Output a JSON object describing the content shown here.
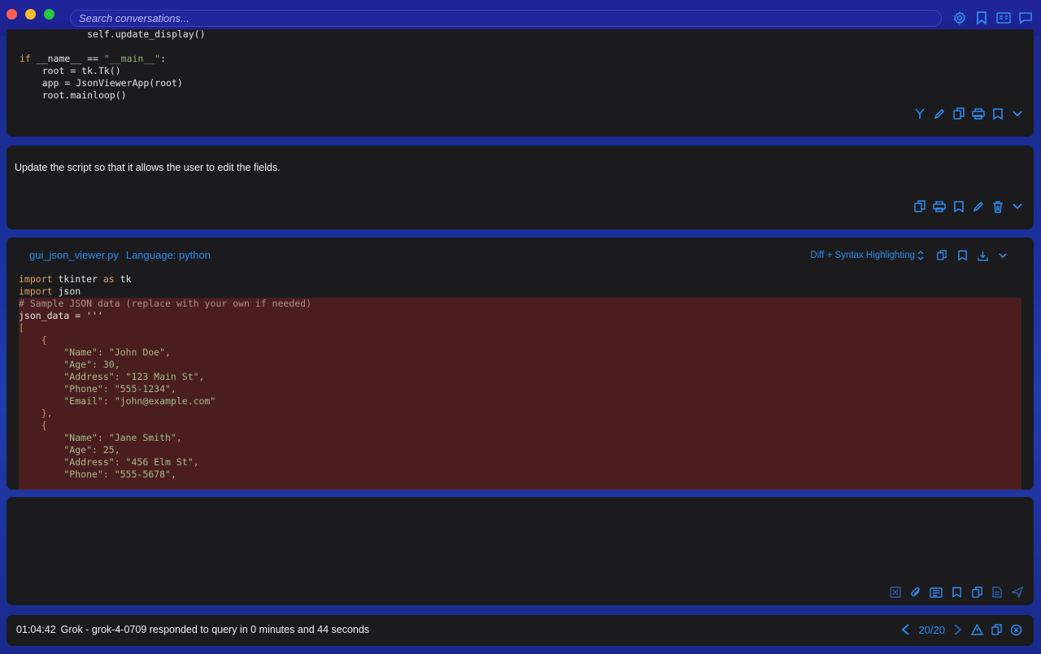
{
  "search": {
    "placeholder": "Search conversations..."
  },
  "colors": {
    "accent": "#2f8cf0",
    "panel_bg": "#1b1b1d",
    "diff_removed_bg": "#4a1e1e",
    "window_bg": "#1c2290"
  },
  "previous_code": {
    "lines": [
      {
        "indent": "            ",
        "text": "self.update_display()"
      },
      {
        "text": ""
      },
      {
        "kw": "if",
        "text": " __name__ == ",
        "str": "\"__main__\"",
        "tail": ":"
      },
      {
        "indent": "    ",
        "text": "root = tk.Tk()"
      },
      {
        "indent": "    ",
        "text": "app = JsonViewerApp(root)"
      },
      {
        "indent": "    ",
        "text": "root.mainloop()"
      }
    ]
  },
  "user_message": {
    "text": "Update the script so that it allows the user to edit the fields."
  },
  "response": {
    "filename": "gui_json_viewer.py",
    "language_label": "Language: python",
    "view_mode": "Diff + Syntax Highlighting",
    "header_lines": [
      {
        "kw": "import",
        "text": " tkinter ",
        "kw2": "as",
        "tail": " tk"
      },
      {
        "kw": "import",
        "text": " json"
      }
    ],
    "diff_lines": [
      "# Sample JSON data (replace with your own if needed)",
      "json_data = '''",
      "[",
      "    {",
      "        \"Name\": \"John Doe\",",
      "        \"Age\": 30,",
      "        \"Address\": \"123 Main St\",",
      "        \"Phone\": \"555-1234\",",
      "        \"Email\": \"john@example.com\"",
      "    },",
      "    {",
      "        \"Name\": \"Jane Smith\",",
      "        \"Age\": 25,",
      "        \"Address\": \"456 Elm St\",",
      "        \"Phone\": \"555-5678\","
    ]
  },
  "status": {
    "time": "01:04:42",
    "message": "Grok - grok-4-0709 responded to query in 0 minutes and 44 seconds",
    "page": "20/20"
  },
  "icons": {
    "titlebar": [
      "gear-icon",
      "bookmark-icon",
      "sidebar-icon",
      "chat-bubble-icon"
    ],
    "code_actions": [
      "fork-icon",
      "edit-icon",
      "copy-icon",
      "print-icon",
      "bookmark-icon",
      "chevron-down-icon"
    ],
    "message_actions": [
      "copy-icon",
      "print-icon",
      "bookmark-icon",
      "edit-icon",
      "trash-icon",
      "chevron-down-icon"
    ],
    "response_actions": [
      "copy-icon",
      "bookmark-icon",
      "download-icon",
      "chevron-down-icon"
    ],
    "input_actions": [
      "clear-icon",
      "paperclip-icon",
      "template-icon",
      "bookmark-icon",
      "copy-icon",
      "file-icon",
      "send-icon"
    ],
    "status_actions": [
      "chevron-left-icon",
      "chevron-right-icon",
      "warning-icon",
      "copy-icon",
      "close-circle-icon"
    ]
  }
}
